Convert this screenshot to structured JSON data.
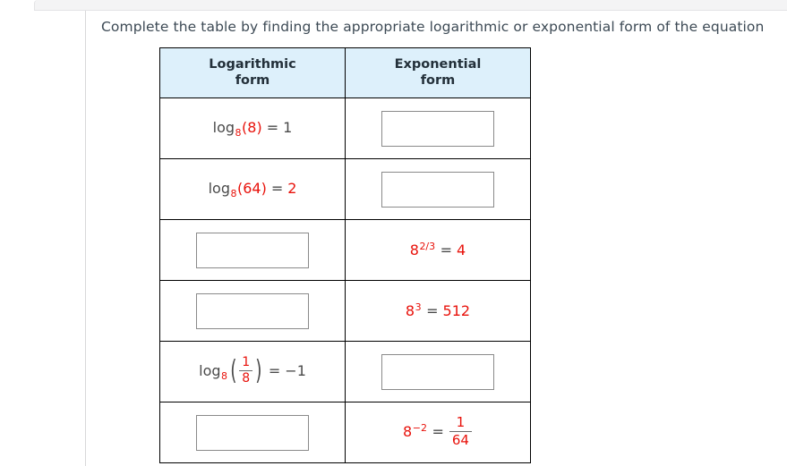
{
  "prompt": "Complete the table by finding the appropriate logarithmic or exponential form of the equation",
  "table": {
    "headers": {
      "col1_line1": "Logarithmic",
      "col1_line2": "form",
      "col2_line1": "Exponential",
      "col2_line2": "form"
    },
    "rows": [
      {
        "id": "row-1",
        "log_form": {
          "type": "given",
          "text": "log8(8) = 1",
          "parts": {
            "log": "log",
            "base": "8",
            "open": "(",
            "arg": "8",
            "close": ")",
            "eq": "=",
            "result": "1"
          }
        },
        "exp_form": {
          "type": "input",
          "value": "",
          "placeholder": ""
        }
      },
      {
        "id": "row-2",
        "log_form": {
          "type": "given",
          "text": "log8(64) = 2",
          "parts": {
            "log": "log",
            "base": "8",
            "open": "(",
            "arg": "64",
            "close": ")",
            "eq": "=",
            "result": "2"
          }
        },
        "exp_form": {
          "type": "input",
          "value": "",
          "placeholder": ""
        }
      },
      {
        "id": "row-3",
        "log_form": {
          "type": "input",
          "value": "",
          "placeholder": ""
        },
        "exp_form": {
          "type": "given",
          "text": "8^(2/3) = 4",
          "parts": {
            "base": "8",
            "exponent": "2/3",
            "eq": "=",
            "result": "4"
          }
        }
      },
      {
        "id": "row-4",
        "log_form": {
          "type": "input",
          "value": "",
          "placeholder": ""
        },
        "exp_form": {
          "type": "given",
          "text": "8^3 = 512",
          "parts": {
            "base": "8",
            "exponent": "3",
            "eq": "=",
            "result": "512"
          }
        }
      },
      {
        "id": "row-5",
        "log_form": {
          "type": "given",
          "text": "log8(1/8) = -1",
          "parts": {
            "log": "log",
            "base": "8",
            "open": "(",
            "num": "1",
            "den": "8",
            "close": ")",
            "eq": "=",
            "result": "−1"
          }
        },
        "exp_form": {
          "type": "input",
          "value": "",
          "placeholder": ""
        }
      },
      {
        "id": "row-6",
        "log_form": {
          "type": "input",
          "value": "",
          "placeholder": ""
        },
        "exp_form": {
          "type": "given",
          "text": "8^(-2) = 1/64",
          "parts": {
            "base": "8",
            "exponent": "−2",
            "eq": "=",
            "num": "1",
            "den": "64"
          }
        }
      }
    ]
  },
  "colors": {
    "header_bg": "#ddf0fb",
    "math_red": "#e8120b",
    "math_gray": "#4a4a4a",
    "prompt_text": "#3d4a55",
    "table_border": "#000000",
    "input_border": "#8a8a8a"
  }
}
